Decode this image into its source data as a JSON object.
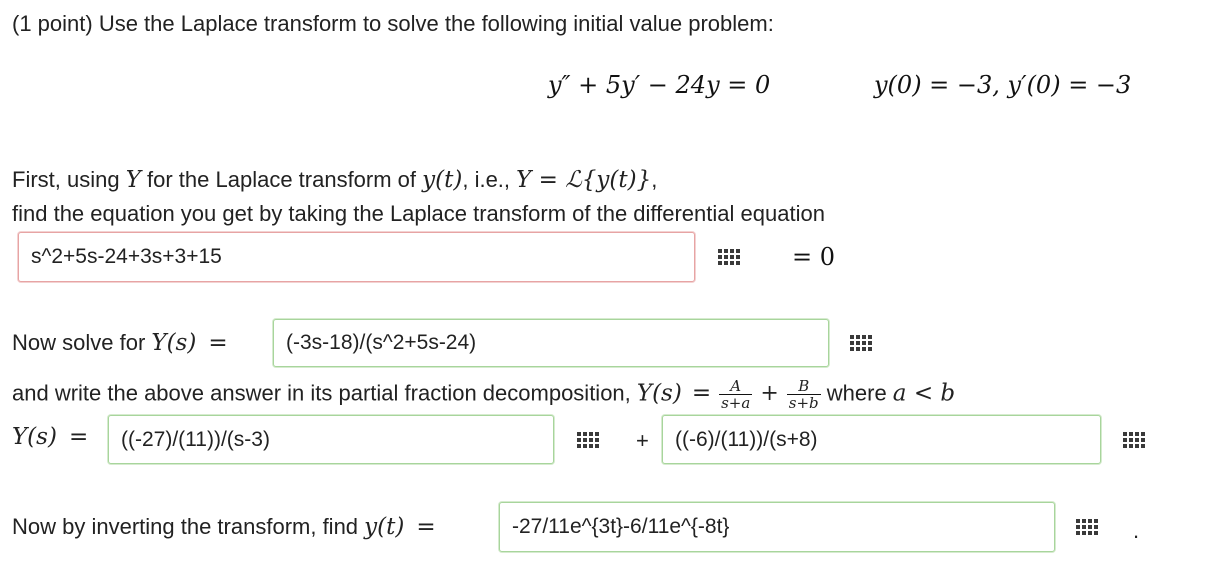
{
  "problem": {
    "intro": "(1 point) Use the Laplace transform to solve the following initial value problem:",
    "ode": "y″ + 5y′ − 24y = 0",
    "initial_conditions": "y(0) = −3,  y′(0) = −3"
  },
  "step1": {
    "line1_pre": "First, using ",
    "line1_Y": "Y",
    "line1_mid": " for the Laplace transform of ",
    "line1_yt": "y(t)",
    "line1_ie": ", i.e., ",
    "line1_def": "Y = ℒ{y(t)}",
    "line1_end": ",",
    "line2": "find the equation you get by taking the Laplace transform of the differential equation",
    "answer": "s^2+5s-24+3s+3+15",
    "equals_zero": "= 0"
  },
  "step2": {
    "label_pre": "Now solve for ",
    "label_math": "Y(s)",
    "label_eq": "=",
    "answer": "(-3s-18)/(s^2+5s-24)"
  },
  "step3": {
    "label_pre": "and write the above answer in its partial fraction decomposition, ",
    "label_math": "Y(s)",
    "label_eq": "=",
    "frac_a_num": "A",
    "frac_a_den": "s+a",
    "plus": "+",
    "frac_b_num": "B",
    "frac_b_den": "s+b",
    "where_text": " where ",
    "where_math": "a < b",
    "row_label": "Y(s)",
    "row_eq": "=",
    "answer_a": "((-27)/(11))/(s-3)",
    "row_plus": "+",
    "answer_b": "((-6)/(11))/(s+8)"
  },
  "step4": {
    "label_pre": "Now by inverting the transform, find ",
    "label_math": "y(t)",
    "label_eq": "=",
    "answer": "-27/11e^{3t}-6/11e^{-8t}",
    "period": "."
  },
  "icons": {
    "palette": "equation-palette-icon"
  },
  "colors": {
    "incorrect_border": "#e7a4a4",
    "correct_border": "#a8d59c"
  }
}
